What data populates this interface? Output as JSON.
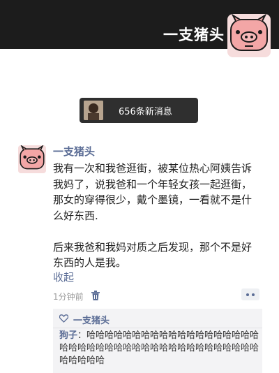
{
  "header": {
    "name": "一支猪头"
  },
  "new_messages": {
    "label": "656条新消息"
  },
  "post": {
    "author": "一支猪头",
    "body": "我有一次和我爸逛街，被某位热心阿姨告诉我妈了，说我爸和一个年轻女孩一起逛街，那女的穿得很少，戴个墨镜，一看就不是什么好东西.\n\n后来我爸和我妈对质之后发现，那个不是好东西的人是我。",
    "collapse_label": "收起",
    "time": "1分钟前"
  },
  "likes": {
    "names": "一支猪头"
  },
  "comments": [
    {
      "author": "狗子",
      "separator": "：",
      "text": "哈哈哈哈哈哈哈哈哈哈哈哈哈哈哈哈哈哈哈哈哈哈哈哈哈哈哈哈哈哈哈哈哈哈哈哈哈哈哈哈哈哈哈哈哈哈"
    }
  ],
  "colors": {
    "header_bg": "#1c1c1c",
    "link_blue": "#5a6c95",
    "avatar_pink": "#f6dcdc"
  }
}
